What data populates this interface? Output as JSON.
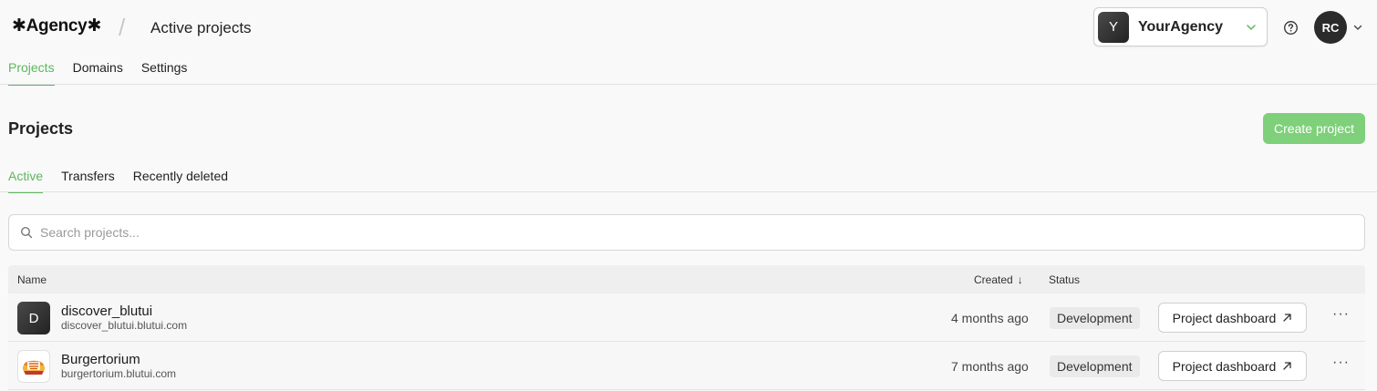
{
  "header": {
    "logo": "✱Agency✱",
    "separator": "/",
    "title": "Active projects",
    "agency": {
      "initial": "Y",
      "name": "YourAgency"
    },
    "user_initials": "RC"
  },
  "nav": {
    "tabs": [
      {
        "label": "Projects",
        "active": true
      },
      {
        "label": "Domains",
        "active": false
      },
      {
        "label": "Settings",
        "active": false
      }
    ]
  },
  "main": {
    "title": "Projects",
    "create_button": "Create project",
    "subtabs": [
      {
        "label": "Active",
        "active": true
      },
      {
        "label": "Transfers",
        "active": false
      },
      {
        "label": "Recently deleted",
        "active": false
      }
    ],
    "search_placeholder": "Search projects...",
    "table": {
      "columns": {
        "name": "Name",
        "created": "Created",
        "status": "Status"
      },
      "sort_arrow": "↓",
      "rows": [
        {
          "avatar": "D",
          "name": "discover_blutui",
          "domain": "discover_blutui.blutui.com",
          "created": "4 months ago",
          "status": "Development",
          "action": "Project dashboard"
        },
        {
          "avatar": "burger-logo",
          "name": "Burgertorium",
          "domain": "burgertorium.blutui.com",
          "created": "7 months ago",
          "status": "Development",
          "action": "Project dashboard"
        }
      ]
    }
  },
  "colors": {
    "accent": "#5cb85c",
    "create_button_bg": "#7ed07b"
  }
}
